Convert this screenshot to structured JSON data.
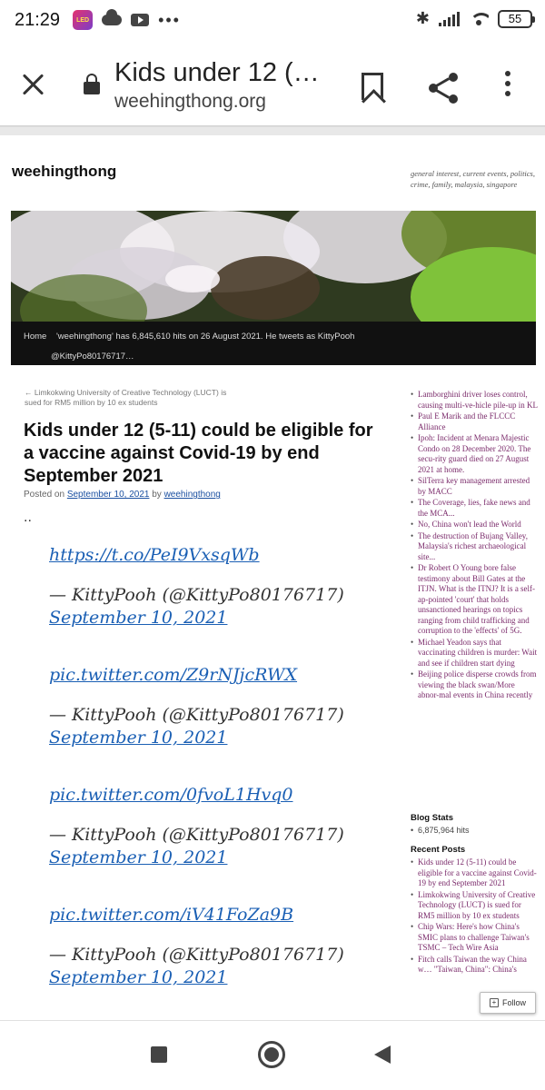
{
  "status_bar": {
    "time": "21:29",
    "battery": "55",
    "app_badge": "LED"
  },
  "browser": {
    "title": "Kids under 12 (…",
    "url": "weehingthong.org"
  },
  "site": {
    "title": "weehingthong",
    "description": "general interest, current events, politics, crime, family, malaysia, singapore",
    "nav": {
      "home": "Home",
      "hits": "'weehingthong' has 6,845,610 hits on 26 August 2021. He tweets as KittyPooh",
      "handle": "@KittyPo80176717…"
    }
  },
  "post": {
    "prev_link": "← Limkokwing University of Creative Technology (LUCT) is sued for RM5 million by 10 ex students",
    "title": "Kids under 12 (5-11) could be eligible for a vaccine against Covid-19 by end September 2021",
    "posted_on": "Posted on",
    "date": "September 10, 2021",
    "by": "by",
    "author": "weehingthong",
    "ellipsis": "..",
    "tweets": [
      {
        "link": "https://t.co/PeI9VxsqWb",
        "author": "— KittyPooh (@KittyPo80176717)",
        "date": "September 10, 2021"
      },
      {
        "link": "pic.twitter.com/Z9rNJjcRWX",
        "author": "— KittyPooh (@KittyPo80176717)",
        "date": "September 10, 2021"
      },
      {
        "link": "pic.twitter.com/0fvoL1Hvq0",
        "author": "— KittyPooh (@KittyPo80176717)",
        "date": "September 10, 2021"
      },
      {
        "link": "pic.twitter.com/iV41FoZa9B",
        "author": "— KittyPooh (@KittyPo80176717)",
        "date": "September 10, 2021"
      }
    ]
  },
  "sidebar": {
    "top_posts": [
      "Lamborghini driver loses control, causing multi-ve-hicle pile-up in KL",
      "Paul E Marik and the FLCCC Alliance",
      "Ipoh: Incident at Menara Majestic Condo on 28 December 2020. The secu-rity guard died on 27 August 2021 at home.",
      "SilTerra key management arrested by MACC",
      "The Coverage, lies, fake news and the MCA...",
      "No, China won't lead the World",
      "The destruction of Bujang Valley, Malaysia's richest archaeological site...",
      "Dr Robert O Young bore false testimony about Bill Gates at the ITJN. What is the ITNJ? It is a self-ap-pointed 'court' that holds unsanctioned hearings on topics ranging from child trafficking and corruption to the 'effects' of 5G.",
      "Michael Yeadon says that vaccinating children is murder: Wait and see if children start dying",
      "Beijing police disperse crowds from viewing the black swan/More abnor-mal events in China recently"
    ],
    "blog_stats_heading": "Blog Stats",
    "blog_stats": "6,875,964 hits",
    "recent_posts_heading": "Recent Posts",
    "recent_posts": [
      "Kids under 12 (5-11) could be eligible for a vaccine against Covid-19 by end September 2021",
      "Limkokwing University of Creative Technology (LUCT) is sued for RM5 million by 10 ex students",
      "Chip Wars: Here's how China's SMIC plans to challenge Taiwan's TSMC – Tech Wire Asia",
      "Fitch calls Taiwan the way China w… \"Taiwan, China\": China's"
    ],
    "follow_label": "Follow"
  },
  "colors": {
    "link": "#1a5fb4",
    "sidebar_link": "#7a2a6a",
    "nav_bg": "#111111"
  },
  "icons": [
    "close-icon",
    "lock-icon",
    "bookmark-icon",
    "share-icon",
    "more-icon",
    "recents-icon",
    "home-icon",
    "back-icon"
  ]
}
